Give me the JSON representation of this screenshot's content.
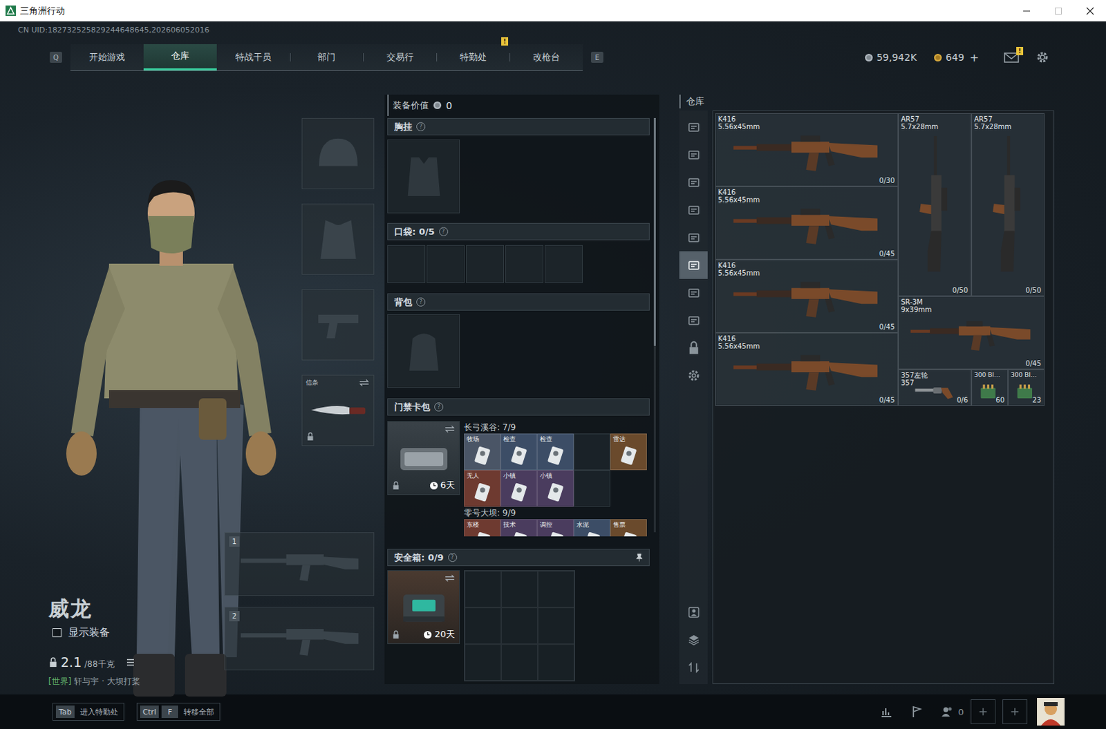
{
  "window": {
    "title": "三角洲行动"
  },
  "uid": "CN UID:182732525829244648645,202606052016",
  "nav": {
    "prev_key": "Q",
    "next_key": "E",
    "alert_mark": "!",
    "tabs": [
      {
        "label": "开始游戏",
        "selected": false,
        "alert": false
      },
      {
        "label": "仓库",
        "selected": true,
        "alert": false
      },
      {
        "label": "特战干员",
        "selected": false,
        "alert": false
      },
      {
        "label": "部门",
        "selected": false,
        "alert": false
      },
      {
        "label": "交易行",
        "selected": false,
        "alert": false
      },
      {
        "label": "特勤处",
        "selected": false,
        "alert": true
      },
      {
        "label": "改枪台",
        "selected": false,
        "alert": false
      }
    ]
  },
  "wallet": {
    "silver": "59,942K",
    "coupon": "649",
    "add": "+"
  },
  "mail": {
    "badge": "!"
  },
  "character": {
    "name": "威龙",
    "show_equipment": {
      "label": "显示装备",
      "checked": false
    },
    "weight": {
      "value": "2.1",
      "max": "/88千克"
    },
    "chat": {
      "channel": "[世界]",
      "text": "轩与宇 · 大坝打桨"
    }
  },
  "slots": {
    "melee": {
      "label": "信条"
    },
    "weapons": [
      {
        "number": "1"
      },
      {
        "number": "2"
      }
    ]
  },
  "loadout": {
    "value_label": "装备价值",
    "value": "0",
    "help": "?",
    "chest": {
      "label": "胸挂"
    },
    "pockets": {
      "label": "口袋:",
      "count": "0/5",
      "slots": [
        {
          "filled": false
        },
        {
          "filled": false
        },
        {
          "filled": false
        },
        {
          "filled": false
        },
        {
          "filled": false
        }
      ]
    },
    "backpack": {
      "label": "背包"
    },
    "keycards": {
      "label": "门禁卡包",
      "expires": "6天",
      "maps": [
        {
          "name": "长弓溪谷:",
          "count": "7/9",
          "cards": [
            {
              "kind": "card",
              "label": "牧场",
              "color": "#4a5566"
            },
            {
              "kind": "card",
              "label": "检查",
              "color": "#3c4d66"
            },
            {
              "kind": "card",
              "label": "检查",
              "color": "#3c4d66"
            },
            {
              "kind": "empty"
            },
            {
              "kind": "card",
              "label": "雷达",
              "color": "#6a4a2c"
            },
            {
              "kind": "card",
              "label": "无人",
              "color": "#6e3a30"
            },
            {
              "kind": "card",
              "label": "小镇",
              "color": "#4a3c5e"
            },
            {
              "kind": "card",
              "label": "小镇",
              "color": "#4a3c5e"
            },
            {
              "kind": "empty"
            }
          ]
        },
        {
          "name": "零号大坝:",
          "count": "9/9",
          "cards": [
            {
              "kind": "card",
              "label": "东楼",
              "color": "#6e3a30"
            },
            {
              "kind": "card",
              "label": "技术",
              "color": "#4a3c5e"
            },
            {
              "kind": "card",
              "label": "调控",
              "color": "#4a3c5e"
            },
            {
              "kind": "card",
              "label": "水泥",
              "color": "#3c4d66"
            },
            {
              "kind": "card",
              "label": "售票",
              "color": "#6a4a2c"
            }
          ]
        }
      ]
    },
    "safe_box": {
      "label": "安全箱:",
      "count": "0/9",
      "expires": "20天",
      "cells": [
        {
          "filled": false
        },
        {
          "filled": false
        },
        {
          "filled": false
        },
        {
          "filled": false
        },
        {
          "filled": false
        },
        {
          "filled": false
        },
        {
          "filled": false
        },
        {
          "filled": false
        },
        {
          "filled": false
        }
      ]
    }
  },
  "warehouse": {
    "title": "仓库",
    "sidebar": [
      {
        "selected": false
      },
      {
        "selected": false
      },
      {
        "selected": false
      },
      {
        "selected": false
      },
      {
        "selected": false
      },
      {
        "selected": true
      },
      {
        "selected": false
      },
      {
        "selected": false
      }
    ],
    "items": [
      {
        "kind": "rifle",
        "name": "K416",
        "caliber": "5.56x45mm",
        "ammo": "0/30"
      },
      {
        "kind": "tall-rifle",
        "name": "AR57",
        "caliber": "5.7x28mm",
        "ammo": "0/50"
      },
      {
        "kind": "tall-rifle",
        "name": "AR57",
        "caliber": "5.7x28mm",
        "ammo": "0/50"
      },
      {
        "kind": "rifle",
        "name": "K416",
        "caliber": "5.56x45mm",
        "ammo": "0/45"
      },
      {
        "kind": "rifle",
        "name": "K416",
        "caliber": "5.56x45mm",
        "ammo": "0/45"
      },
      {
        "kind": "smg",
        "name": "SR-3M",
        "caliber": "9x39mm",
        "ammo": "0/45"
      },
      {
        "kind": "rifle",
        "name": "K416",
        "caliber": "5.56x45mm",
        "ammo": "0/45"
      },
      {
        "kind": "revolver",
        "name": "357左轮",
        "caliber": "357",
        "ammo": "0/6"
      },
      {
        "kind": "ammo",
        "name": "300 Bl…",
        "ammo": "60"
      },
      {
        "kind": "ammo",
        "name": "300 Bl…",
        "ammo": "23"
      }
    ]
  },
  "bottom_bar": {
    "hints": [
      {
        "keys": [
          "Tab"
        ],
        "label": "进入特勤处"
      },
      {
        "keys": [
          "Ctrl",
          "F"
        ],
        "label": "转移全部"
      }
    ],
    "squad_count": "0"
  }
}
